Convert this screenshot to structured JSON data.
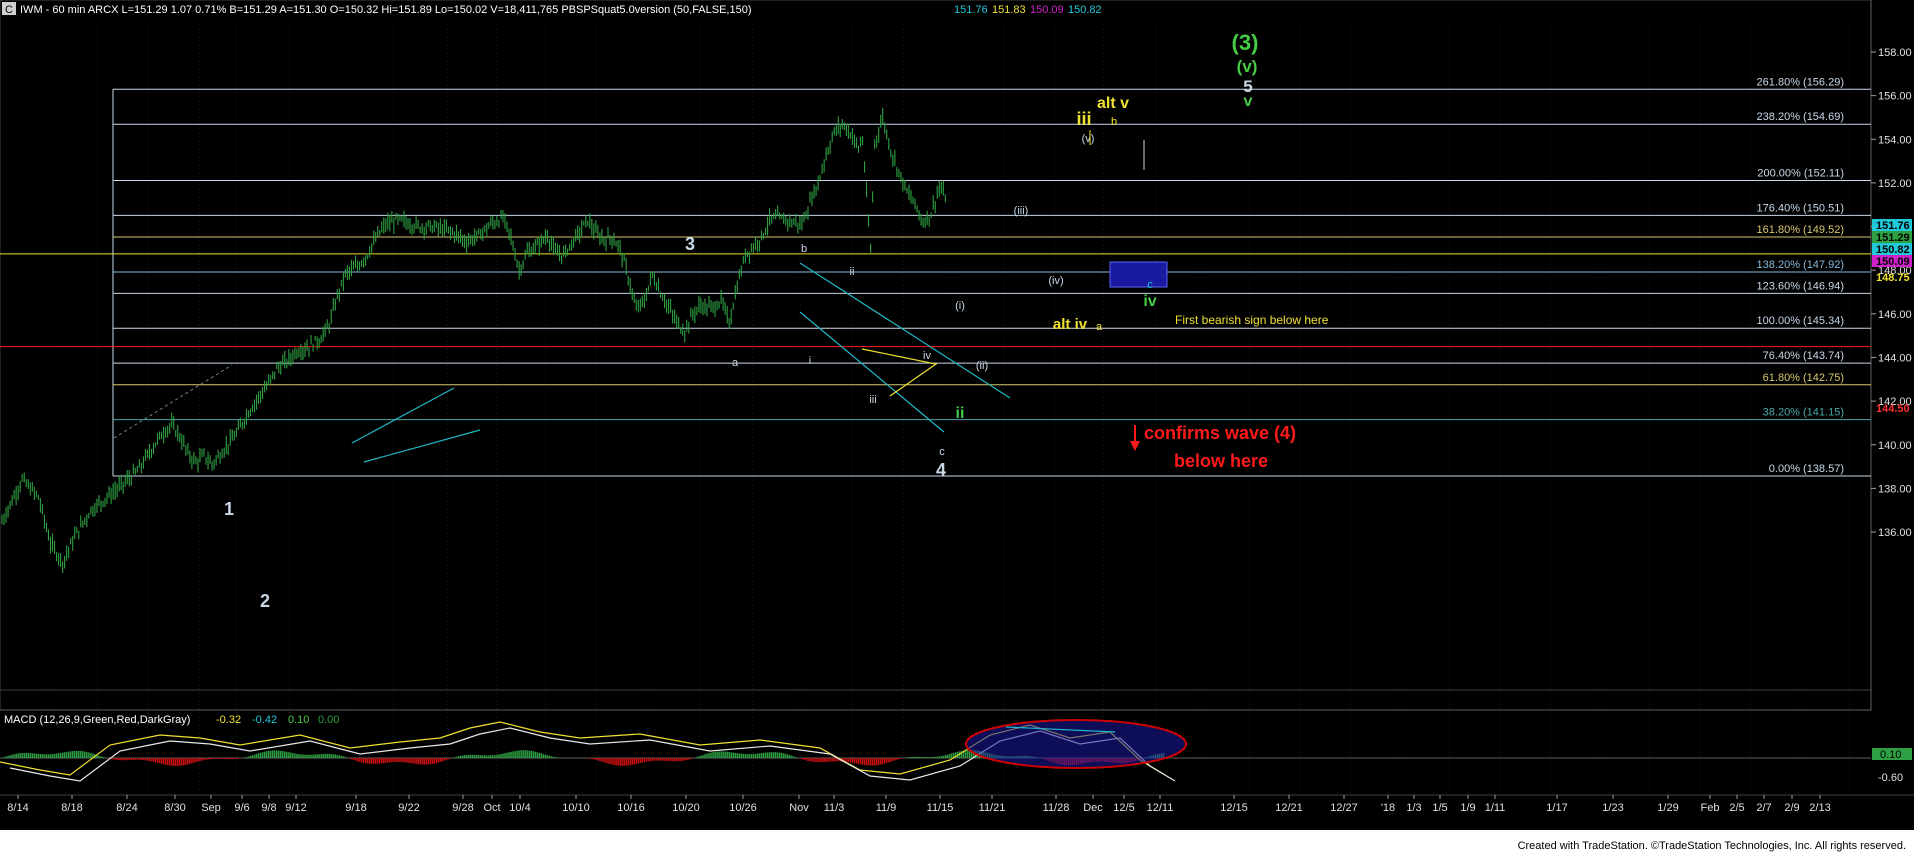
{
  "colors": {
    "background": "#000000",
    "price_bars": "#2ea043",
    "fib_lines": "#c8d8e8",
    "label_text": "#ffffff",
    "yellow": "#f0e030",
    "green": "#44cc44",
    "red": "#ff1a1a",
    "blue_box": "#1a1aa0",
    "macd_box": "#cc0000",
    "axis_text": "#e0e0e0"
  },
  "header": {
    "badge": "C",
    "info": "IWM - 60 min  ARCX  L=151.29  1.07  0.71%  B=151.29  A=151.30  O=150.32  Hi=151.89  Lo=150.02  V=18,411,765  PBSPSquat5.0version (50,FALSE,150)",
    "v1": "151.76",
    "v2": "151.83",
    "v3": "150.09",
    "v4": "150.82"
  },
  "footer": {
    "credit": "Created with TradeStation. ©TradeStation Technologies, Inc. All rights reserved."
  },
  "chart_data": {
    "type": "bar",
    "title": "IWM - 60 min",
    "ylim": [
      134,
      160
    ],
    "yticks": [
      "158.00",
      "156.00",
      "154.00",
      "152.00",
      "150.00",
      "148.00",
      "146.00",
      "144.00",
      "142.00",
      "140.00",
      "138.00",
      "136.00"
    ],
    "xticks": [
      "8/14",
      "8/18",
      "8/24",
      "8/30",
      "Sep",
      "9/6",
      "9/8",
      "9/12",
      "9/18",
      "9/22",
      "9/28",
      "Oct",
      "10/4",
      "10/10",
      "10/16",
      "10/20",
      "10/26",
      "Nov",
      "11/3",
      "11/9",
      "11/15",
      "11/21",
      "11/28",
      "Dec",
      "12/5",
      "12/11",
      "12/15",
      "12/21",
      "12/27",
      "'18",
      "1/3",
      "1/5",
      "1/9",
      "1/11",
      "1/17",
      "1/23",
      "1/29",
      "Feb",
      "2/5",
      "2/7",
      "2/9",
      "2/13"
    ],
    "price_path": [
      [
        0,
        136.5
      ],
      [
        10,
        138.4
      ],
      [
        18,
        137.6
      ],
      [
        24,
        135.5
      ],
      [
        30,
        134.6
      ],
      [
        36,
        135.8
      ],
      [
        44,
        137.0
      ],
      [
        52,
        137.6
      ],
      [
        60,
        138.2
      ],
      [
        68,
        138.9
      ],
      [
        74,
        139.8
      ],
      [
        80,
        140.6
      ],
      [
        84,
        140.9
      ],
      [
        88,
        140.4
      ],
      [
        92,
        139.6
      ],
      [
        96,
        139.2
      ],
      [
        100,
        139.5
      ],
      [
        104,
        139.1
      ],
      [
        110,
        139.8
      ],
      [
        116,
        140.5
      ],
      [
        122,
        141.5
      ],
      [
        128,
        142.3
      ],
      [
        132,
        142.8
      ],
      [
        136,
        143.5
      ],
      [
        142,
        143.9
      ],
      [
        146,
        144.3
      ],
      [
        152,
        144.5
      ],
      [
        158,
        144.9
      ],
      [
        162,
        145.5
      ],
      [
        166,
        146.8
      ],
      [
        170,
        147.8
      ],
      [
        176,
        148.2
      ],
      [
        180,
        148.6
      ],
      [
        186,
        149.6
      ],
      [
        190,
        150.1
      ],
      [
        196,
        150.3
      ],
      [
        200,
        150.2
      ],
      [
        206,
        150.0
      ],
      [
        212,
        150.0
      ],
      [
        218,
        149.9
      ],
      [
        224,
        149.7
      ],
      [
        230,
        149.3
      ],
      [
        236,
        149.6
      ],
      [
        242,
        150.1
      ],
      [
        248,
        150.4
      ],
      [
        252,
        149.5
      ],
      [
        256,
        148.0
      ],
      [
        260,
        148.8
      ],
      [
        266,
        149.2
      ],
      [
        270,
        149.6
      ],
      [
        274,
        148.8
      ],
      [
        278,
        148.7
      ],
      [
        284,
        149.5
      ],
      [
        290,
        150.3
      ],
      [
        294,
        149.7
      ],
      [
        298,
        149.4
      ],
      [
        302,
        149.5
      ],
      [
        306,
        149.0
      ],
      [
        310,
        147.7
      ],
      [
        314,
        146.2
      ],
      [
        318,
        146.6
      ],
      [
        322,
        147.8
      ],
      [
        326,
        147.0
      ],
      [
        330,
        146.3
      ],
      [
        334,
        145.6
      ],
      [
        338,
        145.2
      ],
      [
        342,
        146.0
      ],
      [
        346,
        146.4
      ],
      [
        348,
        146.3
      ],
      [
        352,
        146.3
      ],
      [
        356,
        146.6
      ],
      [
        360,
        145.6
      ],
      [
        364,
        147.3
      ],
      [
        368,
        148.7
      ],
      [
        372,
        149.1
      ],
      [
        376,
        149.5
      ],
      [
        380,
        150.3
      ],
      [
        384,
        150.4
      ],
      [
        388,
        150.3
      ],
      [
        392,
        150.2
      ],
      [
        396,
        150.1
      ],
      [
        400,
        151.1
      ],
      [
        404,
        152.0
      ],
      [
        408,
        153.3
      ],
      [
        412,
        154.3
      ],
      [
        416,
        154.7
      ],
      [
        420,
        154.3
      ],
      [
        424,
        153.6
      ],
      [
        426,
        154.0
      ],
      [
        430,
        148.9
      ],
      [
        432,
        153.8
      ],
      [
        436,
        155.0
      ],
      [
        440,
        153.5
      ],
      [
        444,
        152.5
      ],
      [
        448,
        151.6
      ],
      [
        452,
        151.0
      ],
      [
        456,
        150.2
      ],
      [
        460,
        150.6
      ],
      [
        464,
        151.8
      ],
      [
        468,
        151.2
      ]
    ],
    "fib_levels": [
      {
        "label": "261.80% (156.29)",
        "value": 156.29,
        "color": "#c8d8e8"
      },
      {
        "label": "238.20% (154.69)",
        "value": 154.69,
        "color": "#c8d8e8"
      },
      {
        "label": "200.00% (152.11)",
        "value": 152.11,
        "color": "#c8d8e8"
      },
      {
        "label": "176.40% (150.51)",
        "value": 150.51,
        "color": "#c8d8e8"
      },
      {
        "label": "161.80% (149.52)",
        "value": 149.52,
        "color": "#d8c870"
      },
      {
        "label": "138.20% (147.92)",
        "value": 147.92,
        "color": "#88b8d8"
      },
      {
        "label": "123.60% (146.94)",
        "value": 146.94,
        "color": "#c8d8e8"
      },
      {
        "label": "100.00% (145.34)",
        "value": 145.34,
        "color": "#c8d8e8"
      },
      {
        "label": "76.40% (143.74)",
        "value": 143.74,
        "color": "#c8d8e8"
      },
      {
        "label": "61.80% (142.75)",
        "value": 142.75,
        "color": "#d8c870"
      },
      {
        "label": "38.20% (141.15)",
        "value": 141.15,
        "color": "#48a8a8"
      },
      {
        "label": "0.00% (138.57)",
        "value": 138.57,
        "color": "#c8d8e8"
      }
    ],
    "price_tags": [
      {
        "text": "151.76",
        "value": 151.76,
        "bg": "#20c8d8"
      },
      {
        "text": "151.29",
        "value": 151.29,
        "bg": "#2ea043"
      },
      {
        "text": "150.82",
        "value": 150.82,
        "bg": "#20c8d8"
      },
      {
        "text": "150.09",
        "value": 150.09,
        "bg": "#d020c8"
      },
      {
        "text": "148.75",
        "value": 148.75,
        "bg": "#000000",
        "fg": "#f0e030"
      },
      {
        "text": "144.50",
        "value": 144.5,
        "bg": "#000000",
        "fg": "#ff3030"
      }
    ],
    "annotations": {
      "a1": "1",
      "a2": "2",
      "a3": "3",
      "a4": "4",
      "b": "b",
      "a": "a",
      "ii": "ii",
      "i": "i",
      "iii_s": "iii",
      "iv_s": "iv",
      "c": "c",
      "ii_g": "ii",
      "i_p": "(i)",
      "ii_p": "(ii)",
      "iii_p": "(iii)",
      "iv_p": "(iv)",
      "v_p": "(v)",
      "iii_y": "iii",
      "alt_v": "alt v",
      "alt_iv": "alt iv",
      "b2": "b",
      "a2s": "a",
      "c2": "c",
      "iv_g": "iv",
      "w3": "(3)",
      "wv": "(v)",
      "w5": "5",
      "wv2": "v",
      "bearish": "First bearish sign below here",
      "confirms1": "confirms wave (4)",
      "confirms2": "below here"
    },
    "macd": {
      "label": "MACD (12,26,9,Green,Red,DarkGray)",
      "v1": "-0.32",
      "v2": "-0.42",
      "v3": "0.10",
      "v4": "0.00",
      "yticks": [
        "0.10",
        "-0.60"
      ]
    }
  }
}
